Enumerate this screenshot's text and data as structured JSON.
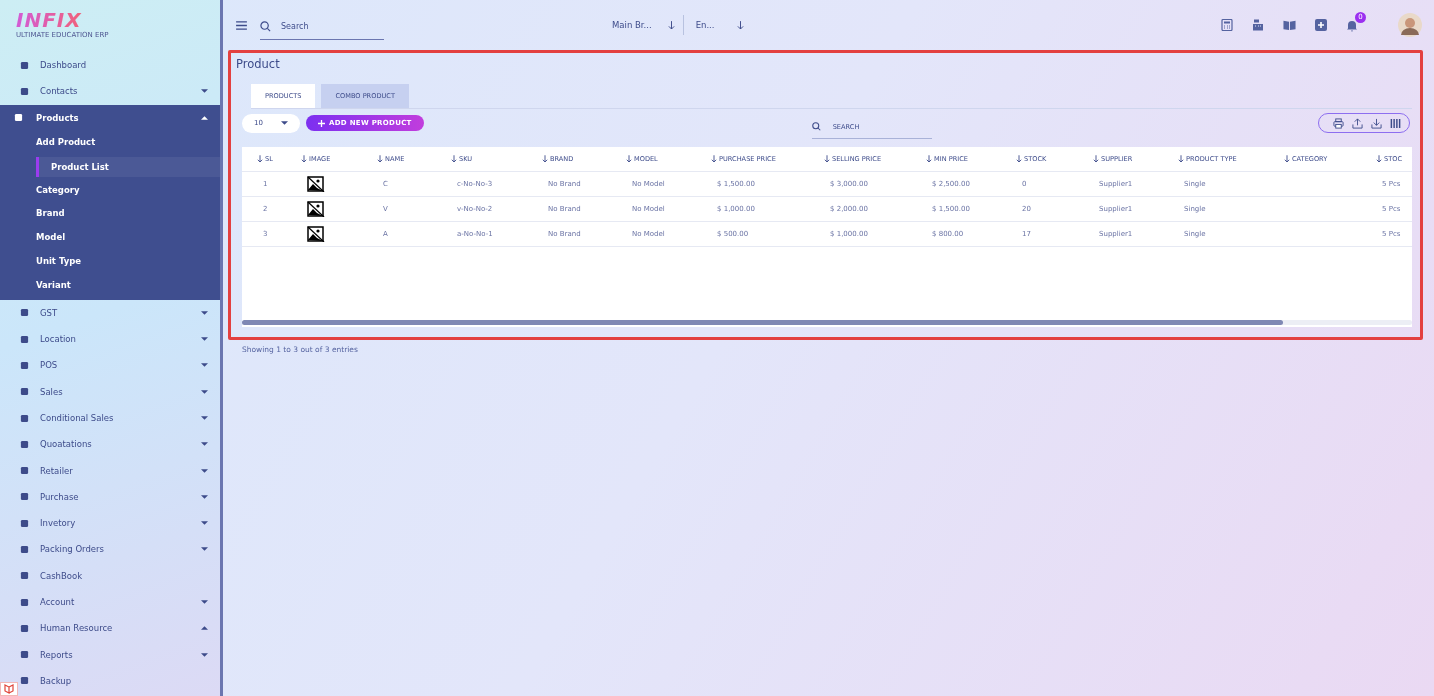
{
  "logo": {
    "name": "INFIX",
    "tagline": "ULTIMATE EDUCATION ERP"
  },
  "sidebar": {
    "items": [
      {
        "label": "Dashboard",
        "has_submenu": false,
        "expanded": false
      },
      {
        "label": "Contacts",
        "has_submenu": true,
        "expanded": false,
        "caret_up": false
      },
      {
        "label": "Products",
        "has_submenu": true,
        "expanded": true,
        "caret_up": true,
        "children": [
          {
            "label": "Add Product",
            "selected": false
          },
          {
            "label": "Product List",
            "selected": true
          },
          {
            "label": "Category",
            "selected": false
          },
          {
            "label": "Brand",
            "selected": false
          },
          {
            "label": "Model",
            "selected": false
          },
          {
            "label": "Unit Type",
            "selected": false
          },
          {
            "label": "Variant",
            "selected": false
          }
        ]
      },
      {
        "label": "GST",
        "has_submenu": true,
        "expanded": false,
        "caret_up": false
      },
      {
        "label": "Location",
        "has_submenu": true,
        "expanded": false,
        "caret_up": false
      },
      {
        "label": "POS",
        "has_submenu": true,
        "expanded": false,
        "caret_up": false
      },
      {
        "label": "Sales",
        "has_submenu": true,
        "expanded": false,
        "caret_up": false
      },
      {
        "label": "Conditional Sales",
        "has_submenu": true,
        "expanded": false,
        "caret_up": false
      },
      {
        "label": "Quoatations",
        "has_submenu": true,
        "expanded": false,
        "caret_up": false
      },
      {
        "label": "Retailer",
        "has_submenu": true,
        "expanded": false,
        "caret_up": false
      },
      {
        "label": "Purchase",
        "has_submenu": true,
        "expanded": false,
        "caret_up": false
      },
      {
        "label": "Invetory",
        "has_submenu": true,
        "expanded": false,
        "caret_up": false
      },
      {
        "label": "Packing Orders",
        "has_submenu": true,
        "expanded": false,
        "caret_up": false
      },
      {
        "label": "CashBook",
        "has_submenu": false,
        "expanded": false
      },
      {
        "label": "Account",
        "has_submenu": true,
        "expanded": false,
        "caret_up": false
      },
      {
        "label": "Human Resource",
        "has_submenu": true,
        "expanded": false,
        "caret_up": true
      },
      {
        "label": "Reports",
        "has_submenu": true,
        "expanded": false,
        "caret_up": false
      },
      {
        "label": "Backup",
        "has_submenu": false,
        "expanded": false
      }
    ]
  },
  "topbar": {
    "search": {
      "placeholder": "Search"
    },
    "branch": "Main Br...",
    "language": "En...",
    "notifications": "0"
  },
  "page": {
    "title": "Product",
    "tabs": [
      {
        "label": "PRODUCTS",
        "selected": true
      },
      {
        "label": "COMBO PRODUCT",
        "selected": false
      }
    ],
    "per_page": "10",
    "add_button": "ADD NEW PRODUCT",
    "search": {
      "placeholder": "SEARCH"
    },
    "table": {
      "columns": [
        "SL",
        "IMAGE",
        "NAME",
        "SKU",
        "BRAND",
        "MODEL",
        "PURCHASE PRICE",
        "SELLING PRICE",
        "MIN PRICE",
        "STOCK",
        "SUPPLIER",
        "PRODUCT TYPE",
        "CATEGORY",
        "STOC"
      ],
      "rows": [
        {
          "sl": "1",
          "name": "C",
          "sku": "c-No-No-3",
          "brand": "No Brand",
          "model": "No Model",
          "purchase_price": "$ 1,500.00",
          "selling_price": "$ 3,000.00",
          "min_price": "$ 2,500.00",
          "stock": "0",
          "supplier": "Supplier1",
          "product_type": "Single",
          "column_14": "5 Pcs"
        },
        {
          "sl": "2",
          "name": "V",
          "sku": "v-No-No-2",
          "brand": "No Brand",
          "model": "No Model",
          "purchase_price": "$ 1,000.00",
          "selling_price": "$ 2,000.00",
          "min_price": "$ 1,500.00",
          "stock": "20",
          "supplier": "Supplier1",
          "product_type": "Single",
          "column_14": "5 Pcs"
        },
        {
          "sl": "3",
          "name": "A",
          "sku": "a-No-No-1",
          "brand": "No Brand",
          "model": "No Model",
          "purchase_price": "$ 500.00",
          "selling_price": "$ 1,000.00",
          "min_price": "$ 800.00",
          "stock": "17",
          "supplier": "Supplier1",
          "product_type": "Single",
          "column_14": "5 Pcs"
        }
      ]
    },
    "footer": "Showing 1 to 3 out of 3 entries"
  }
}
